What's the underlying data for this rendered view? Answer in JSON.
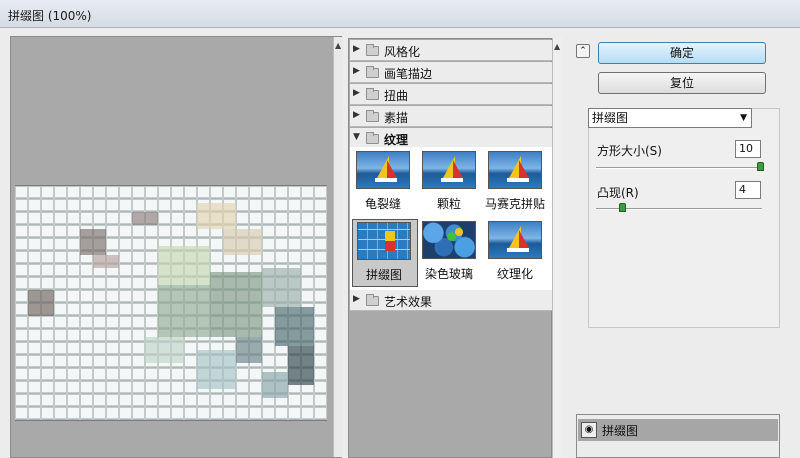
{
  "window": {
    "title": "拼缀图 (100%)"
  },
  "gallery": {
    "categories": [
      "风格化",
      "画笔描边",
      "扭曲",
      "素描",
      "纹理",
      "艺术效果"
    ],
    "expanded_label": "纹理",
    "filters": [
      "龟裂缝",
      "颗粒",
      "马赛克拼贴",
      "拼缀图",
      "染色玻璃",
      "纹理化"
    ],
    "selected": "拼缀图"
  },
  "controls": {
    "ok": "确定",
    "reset": "复位",
    "filter_select": "拼缀图",
    "square_size_label": "方形大小(S)",
    "square_size_value": "10",
    "relief_label": "凸现(R)",
    "relief_value": "4"
  },
  "layers": {
    "item": "拼缀图"
  },
  "icons": {
    "collapse": "double-chevron-up-icon",
    "eye": "eye-icon",
    "folder": "folder-icon",
    "triangle": "disclosure-triangle-icon"
  }
}
